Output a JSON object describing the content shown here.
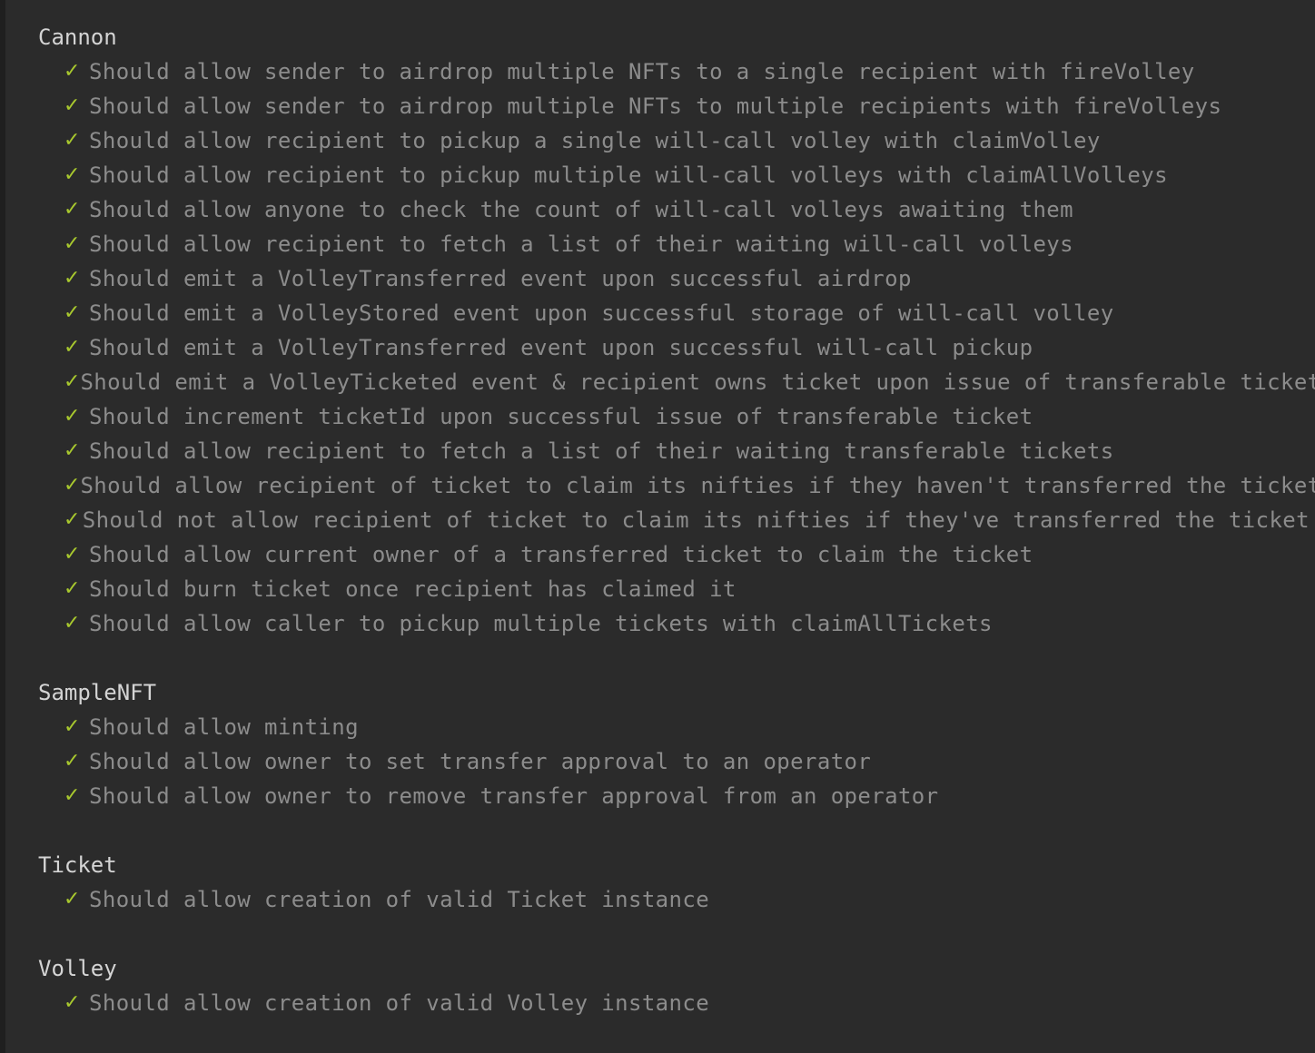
{
  "colors": {
    "background": "#2b2b2b",
    "suite_title": "#d4d4d4",
    "test_text": "#8c8c8c",
    "check": "#a8c82e"
  },
  "suites": [
    {
      "title": "Cannon",
      "tests": [
        {
          "icon": "check-icon",
          "check": "✓",
          "text": "Should allow sender to airdrop multiple NFTs to a single recipient with fireVolley"
        },
        {
          "icon": "check-icon",
          "check": "✓",
          "text": "Should allow sender to airdrop multiple NFTs to multiple recipients with fireVolleys"
        },
        {
          "icon": "check-icon",
          "check": "✓",
          "text": "Should allow recipient to pickup a single will-call volley with claimVolley"
        },
        {
          "icon": "check-icon",
          "check": "✓",
          "text": "Should allow recipient to pickup multiple will-call volleys with claimAllVolleys"
        },
        {
          "icon": "check-icon",
          "check": "✓",
          "text": "Should allow anyone to check the count of will-call volleys awaiting them"
        },
        {
          "icon": "check-icon",
          "check": "✓",
          "text": "Should allow recipient to fetch a list of their waiting will-call volleys"
        },
        {
          "icon": "check-icon",
          "check": "✓",
          "text": "Should emit a VolleyTransferred event upon successful airdrop"
        },
        {
          "icon": "check-icon",
          "check": "✓",
          "text": "Should emit a VolleyStored event upon successful storage of will-call volley"
        },
        {
          "icon": "check-icon",
          "check": "✓",
          "text": "Should emit a VolleyTransferred event upon successful will-call pickup"
        },
        {
          "icon": "check-icon",
          "check": "✓",
          "text": "Should emit a VolleyTicketed event & recipient owns ticket upon issue of transferable ticket"
        },
        {
          "icon": "check-icon",
          "check": "✓",
          "text": "Should increment ticketId upon successful issue of transferable ticket"
        },
        {
          "icon": "check-icon",
          "check": "✓",
          "text": "Should allow recipient to fetch a list of their waiting transferable tickets"
        },
        {
          "icon": "check-icon",
          "check": "✓",
          "text": "Should allow recipient of ticket to claim its nifties if they haven't transferred the ticket"
        },
        {
          "icon": "check-icon",
          "check": "✓",
          "text": "Should not allow recipient of ticket to claim its nifties if they've transferred the ticket"
        },
        {
          "icon": "check-icon",
          "check": "✓",
          "text": "Should allow current owner of a transferred ticket to claim the ticket"
        },
        {
          "icon": "check-icon",
          "check": "✓",
          "text": "Should burn ticket once recipient has claimed it"
        },
        {
          "icon": "check-icon",
          "check": "✓",
          "text": "Should allow caller to pickup multiple tickets with claimAllTickets"
        }
      ]
    },
    {
      "title": "SampleNFT",
      "tests": [
        {
          "icon": "check-icon",
          "check": "✓",
          "text": "Should allow minting"
        },
        {
          "icon": "check-icon",
          "check": "✓",
          "text": "Should allow owner to set transfer approval to an operator"
        },
        {
          "icon": "check-icon",
          "check": "✓",
          "text": "Should allow owner to remove transfer approval from an operator"
        }
      ]
    },
    {
      "title": "Ticket",
      "tests": [
        {
          "icon": "check-icon",
          "check": "✓",
          "text": "Should allow creation of valid Ticket instance"
        }
      ]
    },
    {
      "title": "Volley",
      "tests": [
        {
          "icon": "check-icon",
          "check": "✓",
          "text": "Should allow creation of valid Volley instance"
        }
      ]
    }
  ]
}
